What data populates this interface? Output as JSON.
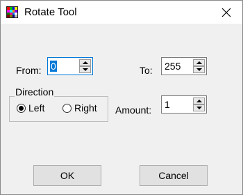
{
  "window": {
    "title": "Rotate Tool"
  },
  "from": {
    "label": "From:",
    "value": "0"
  },
  "to": {
    "label": "To:",
    "value": "255"
  },
  "direction": {
    "label": "Direction",
    "options": [
      {
        "label": "Left",
        "selected": true
      },
      {
        "label": "Right",
        "selected": false
      }
    ]
  },
  "amount": {
    "label": "Amount:",
    "value": "1"
  },
  "buttons": {
    "ok": "OK",
    "cancel": "Cancel"
  },
  "colors": {
    "accent": "#0078d7",
    "window_bg": "#f0f0f0",
    "titlebar_bg": "#ffffff"
  },
  "icons": [
    "palette-grid-icon",
    "close-icon",
    "spin-up-icon",
    "spin-down-icon"
  ]
}
